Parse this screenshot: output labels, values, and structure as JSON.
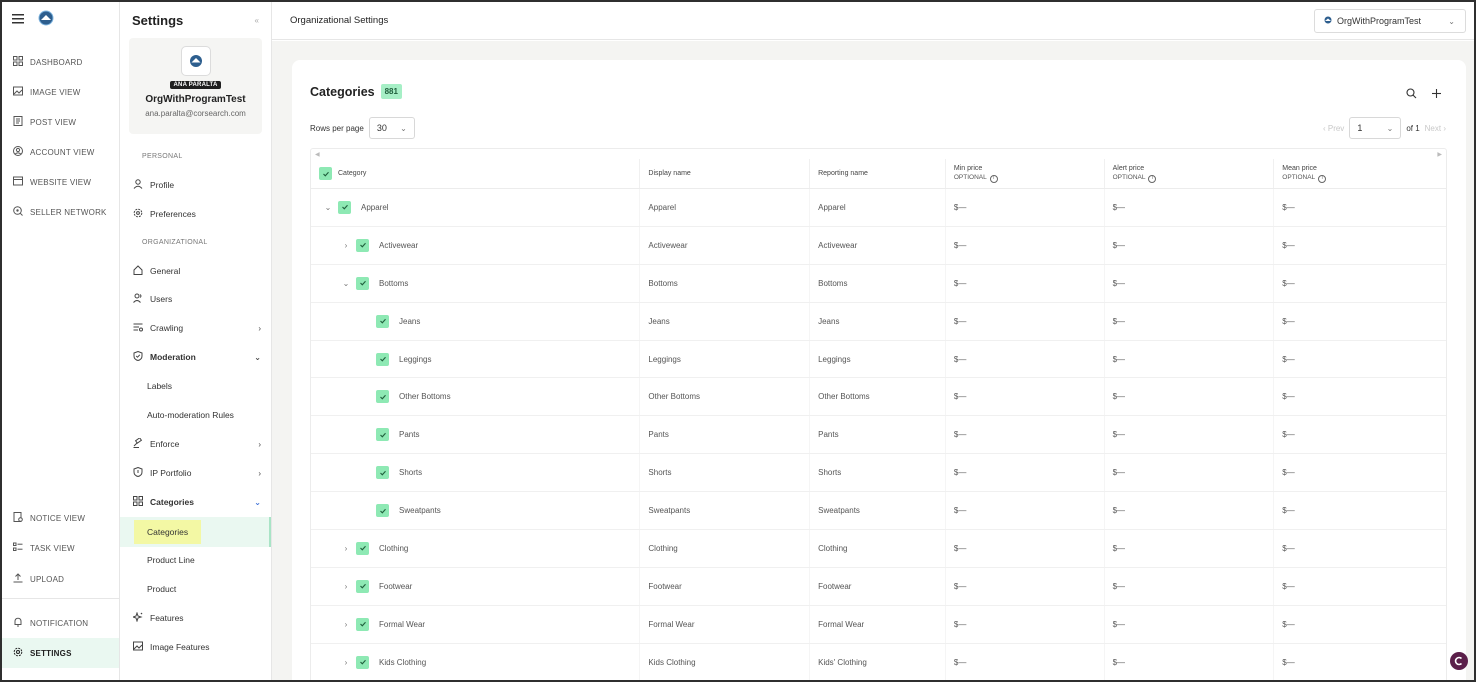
{
  "rail": {
    "items": [
      {
        "label": "DASHBOARD",
        "icon": "dashboard-icon"
      },
      {
        "label": "IMAGE VIEW",
        "icon": "image-icon"
      },
      {
        "label": "POST VIEW",
        "icon": "post-icon"
      },
      {
        "label": "ACCOUNT VIEW",
        "icon": "account-icon"
      },
      {
        "label": "WEBSITE VIEW",
        "icon": "website-icon"
      },
      {
        "label": "SELLER NETWORK",
        "icon": "seller-network-icon"
      }
    ],
    "bottom_items": [
      {
        "label": "NOTICE VIEW",
        "icon": "notice-icon"
      },
      {
        "label": "TASK VIEW",
        "icon": "task-icon"
      },
      {
        "label": "UPLOAD",
        "icon": "upload-icon"
      }
    ],
    "notification": "NOTIFICATION",
    "settings": "SETTINGS"
  },
  "settings": {
    "title": "Settings",
    "close": "«",
    "user_tag": "ANA PARALTA",
    "org_name": "OrgWithProgramTest",
    "email": "ana.paralta@corsearch.com",
    "section_personal": "PERSONAL",
    "profile": "Profile",
    "preferences": "Preferences",
    "section_org": "ORGANIZATIONAL",
    "general": "General",
    "users": "Users",
    "crawling": "Crawling",
    "moderation": "Moderation",
    "labels": "Labels",
    "auto_moderation": "Auto-moderation Rules",
    "enforce": "Enforce",
    "ip_portfolio": "IP Portfolio",
    "categories": "Categories",
    "categories_sub": "Categories",
    "product_line": "Product Line",
    "product": "Product",
    "features": "Features",
    "image_features": "Image Features"
  },
  "topbar": {
    "title": "Organizational Settings",
    "org_select": "OrgWithProgramTest"
  },
  "card": {
    "title": "Categories",
    "count": "881",
    "rows_per_page_label": "Rows per page",
    "rows_per_page": "30",
    "prev": "‹ Prev",
    "page": "1",
    "of": "of 1",
    "next": "Next ›"
  },
  "table": {
    "headers": {
      "category": "Category",
      "display_name": "Display name",
      "reporting_name": "Reporting name",
      "min_price": "Min price",
      "alert_price": "Alert price",
      "mean_price": "Mean price",
      "optional": "OPTIONAL"
    },
    "rows": [
      {
        "caret": "⌄",
        "level": 0,
        "category": "Apparel",
        "display": "Apparel",
        "reporting": "Apparel",
        "min": "$—",
        "alert": "$—",
        "mean": "$—"
      },
      {
        "caret": "›",
        "level": 1,
        "category": "Activewear",
        "display": "Activewear",
        "reporting": "Activewear",
        "min": "$—",
        "alert": "$—",
        "mean": "$—"
      },
      {
        "caret": "⌄",
        "level": 1,
        "category": "Bottoms",
        "display": "Bottoms",
        "reporting": "Bottoms",
        "min": "$—",
        "alert": "$—",
        "mean": "$—"
      },
      {
        "caret": "",
        "level": 2,
        "category": "Jeans",
        "display": "Jeans",
        "reporting": "Jeans",
        "min": "$—",
        "alert": "$—",
        "mean": "$—"
      },
      {
        "caret": "",
        "level": 2,
        "category": "Leggings",
        "display": "Leggings",
        "reporting": "Leggings",
        "min": "$—",
        "alert": "$—",
        "mean": "$—"
      },
      {
        "caret": "",
        "level": 2,
        "category": "Other Bottoms",
        "display": "Other Bottoms",
        "reporting": "Other Bottoms",
        "min": "$—",
        "alert": "$—",
        "mean": "$—"
      },
      {
        "caret": "",
        "level": 2,
        "category": "Pants",
        "display": "Pants",
        "reporting": "Pants",
        "min": "$—",
        "alert": "$—",
        "mean": "$—"
      },
      {
        "caret": "",
        "level": 2,
        "category": "Shorts",
        "display": "Shorts",
        "reporting": "Shorts",
        "min": "$—",
        "alert": "$—",
        "mean": "$—"
      },
      {
        "caret": "",
        "level": 2,
        "category": "Sweatpants",
        "display": "Sweatpants",
        "reporting": "Sweatpants",
        "min": "$—",
        "alert": "$—",
        "mean": "$—"
      },
      {
        "caret": "›",
        "level": 1,
        "category": "Clothing",
        "display": "Clothing",
        "reporting": "Clothing",
        "min": "$—",
        "alert": "$—",
        "mean": "$—"
      },
      {
        "caret": "›",
        "level": 1,
        "category": "Footwear",
        "display": "Footwear",
        "reporting": "Footwear",
        "min": "$—",
        "alert": "$—",
        "mean": "$—"
      },
      {
        "caret": "›",
        "level": 1,
        "category": "Formal Wear",
        "display": "Formal Wear",
        "reporting": "Formal Wear",
        "min": "$—",
        "alert": "$—",
        "mean": "$—"
      },
      {
        "caret": "›",
        "level": 1,
        "category": "Kids Clothing",
        "display": "Kids Clothing",
        "reporting": "Kids' Clothing",
        "min": "$—",
        "alert": "$—",
        "mean": "$—"
      }
    ]
  },
  "colors": {
    "accent_green": "#8ee9b4",
    "badge_green": "#a6efc6",
    "active_bg": "#eaf8f1",
    "highlight_yellow": "#f3f8a4",
    "brand_purple": "#5b1f4a"
  }
}
